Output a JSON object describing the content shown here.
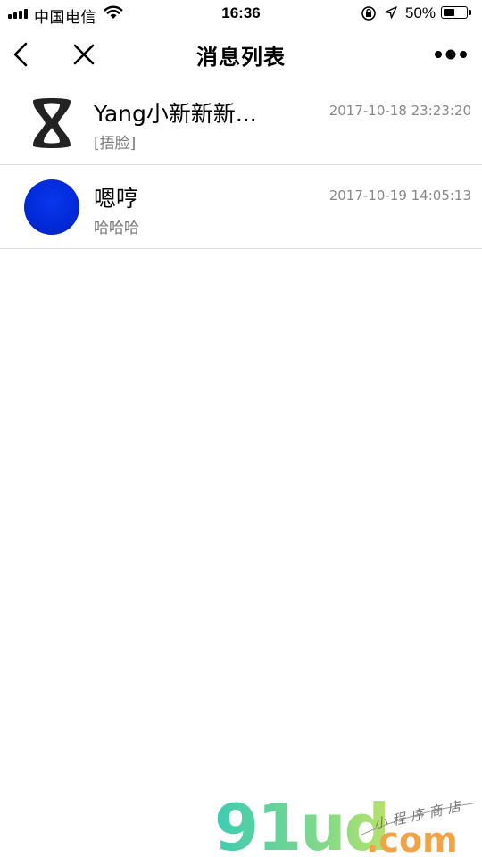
{
  "status_bar": {
    "carrier": "中国电信",
    "time": "16:36",
    "battery_percent": "50%",
    "battery_level": 0.5
  },
  "nav": {
    "title": "消息列表",
    "back_icon": "chevron-left-icon",
    "close_icon": "close-icon",
    "more_icon": "more-dots-icon"
  },
  "messages": [
    {
      "name": "Yang小新新新...",
      "preview": "[捂脸]",
      "time": "2017-10-18 23:23:20",
      "avatar": "figure-eight-logo"
    },
    {
      "name": "嗯哼",
      "preview": "哈哈哈",
      "time": "2017-10-19 14:05:13",
      "avatar": "blue-circle",
      "avatar_color": "#0029d6"
    }
  ],
  "watermark": {
    "brand": "91ud",
    "domain": ".com",
    "tagline": "小程序商店"
  }
}
